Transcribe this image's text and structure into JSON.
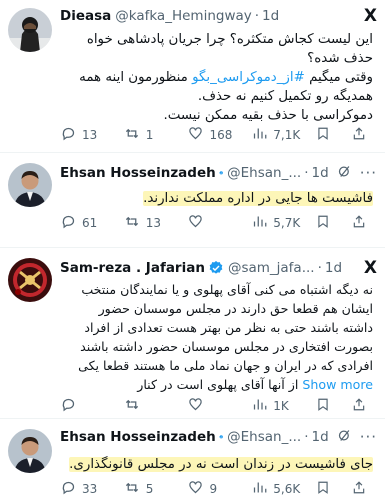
{
  "tweets": [
    {
      "name": "Dieasa",
      "handle": "@kafka_Hemingway",
      "time": "1d",
      "lines": [
        "این لیست کجاش متکثره؟ چرا جریان پادشاهی خواه",
        "حذف شده؟",
        "وقتی میگیم #از_دموکراسی_بگو منظورمون اینه همه",
        "همدیگه رو تکمیل کنیم نه حذف.",
        "دموکراسی با حذف بقیه ممکن نیست."
      ],
      "line3_text": " منظورمون اینه همه",
      "hashtag": "#از_دموکراسی_بگو",
      "line3_prefix": "وقتی میگیم ",
      "replies": "13",
      "reposts": "1",
      "likes": "168",
      "views": "7,1K"
    },
    {
      "name": "Ehsan Hosseinzadeh",
      "handle": "@Ehsan_...",
      "time": "1d",
      "text": "فاشیست ها جایی در اداره مملکت ندارند.",
      "replies": "61",
      "reposts": "13",
      "likes": "",
      "views": "5,7K"
    },
    {
      "name": "Sam-reza . Jafarian",
      "handle": "@sam_jafa...",
      "time": "1d",
      "lines": [
        "نه دیگه اشتباه می کنی آقای پهلوی و یا نمایندگان منتخب",
        "ایشان هم قطعا حق دارند در مجلس موسسان حضور",
        "داشته باشند حتی به نظر من بهتر هست تعدادی از افراد",
        "بصورت افتخاری در مجلس موسسان حضور داشته باشند",
        "افرادی که در ایران و جهان نماد ملی ما هستند قطعا یکی",
        "از آنها آقای پهلوی است در کنار"
      ],
      "show_more": "Show more",
      "replies": "",
      "reposts": "",
      "likes": "",
      "views": "1K"
    },
    {
      "name": "Ehsan Hosseinzadeh",
      "handle": "@Ehsan_...",
      "time": "1d",
      "text": "جای فاشیست در زندان است نه در مجلس قانونگذاری.",
      "replies": "33",
      "reposts": "5",
      "likes": "9",
      "views": "5,6K"
    }
  ],
  "icons": {
    "x_logo": "X",
    "more": "···",
    "grok": "grok-icon",
    "reply": "reply-icon",
    "repost": "repost-icon",
    "like": "like-icon",
    "views": "views-icon",
    "bookmark": "bookmark-icon",
    "share": "share-icon"
  },
  "colors": {
    "verified": "#1d9bf0",
    "link": "#1d9bf0",
    "highlight": "#fdf6b8",
    "muted": "#536471"
  }
}
